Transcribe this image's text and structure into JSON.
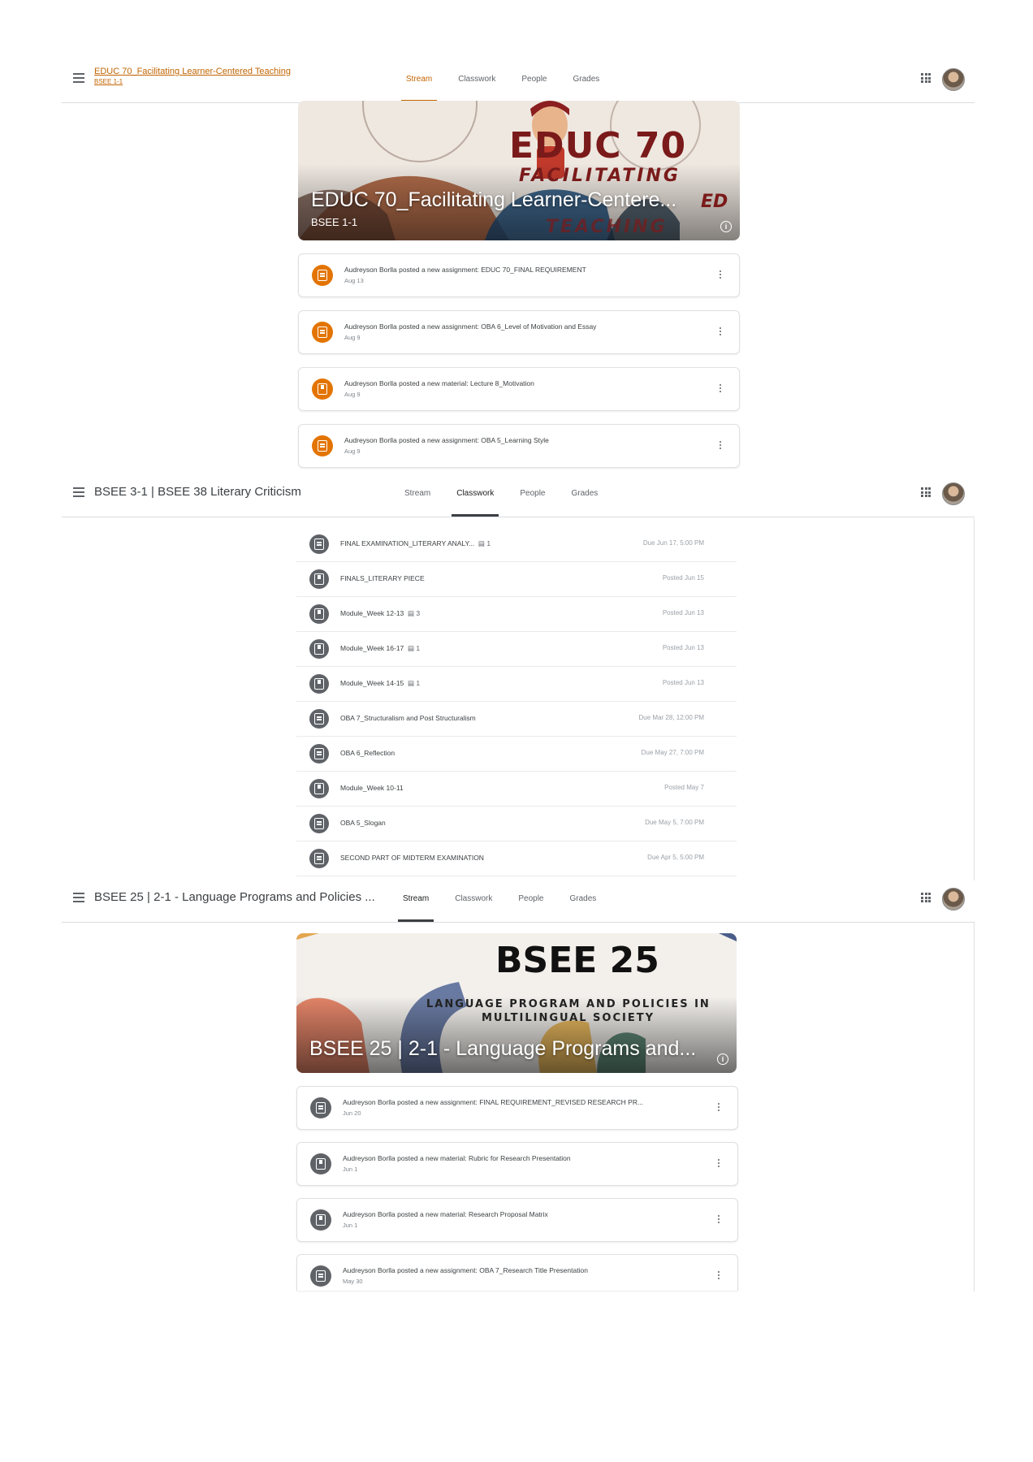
{
  "class1": {
    "title": "EDUC 70_Facilitating Learner-Centered Teaching",
    "section": "BSEE 1-1",
    "tabs": [
      "Stream",
      "Classwork",
      "People",
      "Grades"
    ],
    "banner": {
      "art_line1": "EDUC 70",
      "art_line2": "FACILITATING",
      "art_line3": "TEACHING",
      "art_overlap": "ED",
      "title": "EDUC 70_Facilitating Learner-Centere...",
      "section": "BSEE 1-1"
    },
    "posts": [
      {
        "text": "Audreyson Borlla posted a new assignment: EDUC 70_FINAL REQUIREMENT",
        "date": "Aug 13",
        "kind": "assignment"
      },
      {
        "text": "Audreyson Borlla posted a new assignment: OBA 6_Level of Motivation and Essay",
        "date": "Aug 9",
        "kind": "assignment"
      },
      {
        "text": "Audreyson Borlla posted a new material: Lecture 8_Motivation",
        "date": "Aug 9",
        "kind": "material"
      },
      {
        "text": "Audreyson Borlla posted a new assignment: OBA 5_Learning Style",
        "date": "Aug 9",
        "kind": "assignment"
      }
    ]
  },
  "class2": {
    "title": "BSEE 3-1 | BSEE 38 Literary Criticism",
    "tabs": [
      "Stream",
      "Classwork",
      "People",
      "Grades"
    ],
    "items": [
      {
        "title": "FINAL EXAMINATION_LITERARY ANALY...",
        "count": "1",
        "date": "Due Jun 17, 5:00 PM",
        "kind": "assignment"
      },
      {
        "title": "FINALS_LITERARY PIECE",
        "count": "",
        "date": "Posted Jun 15",
        "kind": "material"
      },
      {
        "title": "Module_Week 12-13",
        "count": "3",
        "date": "Posted Jun 13",
        "kind": "material"
      },
      {
        "title": "Module_Week 16-17",
        "count": "1",
        "date": "Posted Jun 13",
        "kind": "material"
      },
      {
        "title": "Module_Week 14-15",
        "count": "1",
        "date": "Posted Jun 13",
        "kind": "material"
      },
      {
        "title": "OBA 7_Structuralism and Post Structuralism",
        "count": "",
        "date": "Due Mar 28, 12:00 PM",
        "kind": "assignment"
      },
      {
        "title": "OBA 6_Reflection",
        "count": "",
        "date": "Due May 27, 7:00 PM",
        "kind": "assignment"
      },
      {
        "title": "Module_Week 10-11",
        "count": "",
        "date": "Posted May 7",
        "kind": "material"
      },
      {
        "title": "OBA 5_Slogan",
        "count": "",
        "date": "Due May 5, 7:00 PM",
        "kind": "assignment"
      },
      {
        "title": "SECOND PART OF MIDTERM EXAMINATION",
        "count": "",
        "date": "Due Apr 5, 5:00 PM",
        "kind": "assignment"
      }
    ]
  },
  "class3": {
    "title": "BSEE 25 | 2-1 - Language Programs and Policies ...",
    "tabs": [
      "Stream",
      "Classwork",
      "People",
      "Grades"
    ],
    "banner": {
      "art_line1": "BSEE 25",
      "art_line2": "LANGUAGE PROGRAM AND POLICIES IN",
      "art_line3": "MULTILINGUAL SOCIETY",
      "title": "BSEE 25 | 2-1 - Language Programs and..."
    },
    "posts": [
      {
        "text": "Audreyson Borlla posted a new assignment: FINAL REQUIREMENT_REVISED RESEARCH PR...",
        "date": "Jun 20",
        "kind": "assignment"
      },
      {
        "text": "Audreyson Borlla posted a new material: Rubric for Research Presentation",
        "date": "Jun 1",
        "kind": "material"
      },
      {
        "text": "Audreyson Borlla posted a new material: Research Proposal Matrix",
        "date": "Jun 1",
        "kind": "material"
      },
      {
        "text": "Audreyson Borlla posted a new assignment: OBA 7_Research Title Presentation",
        "date": "May 30",
        "kind": "assignment"
      }
    ]
  },
  "icons": {
    "menu": "hamburger-menu-icon",
    "apps": "google-apps-icon",
    "assignment": "assignment-icon",
    "material": "material-icon",
    "more": "more-vert-icon",
    "info": "info-icon"
  },
  "colors": {
    "accent": "#e37400",
    "link": "#c26401",
    "icon_gray": "#5f6368"
  }
}
